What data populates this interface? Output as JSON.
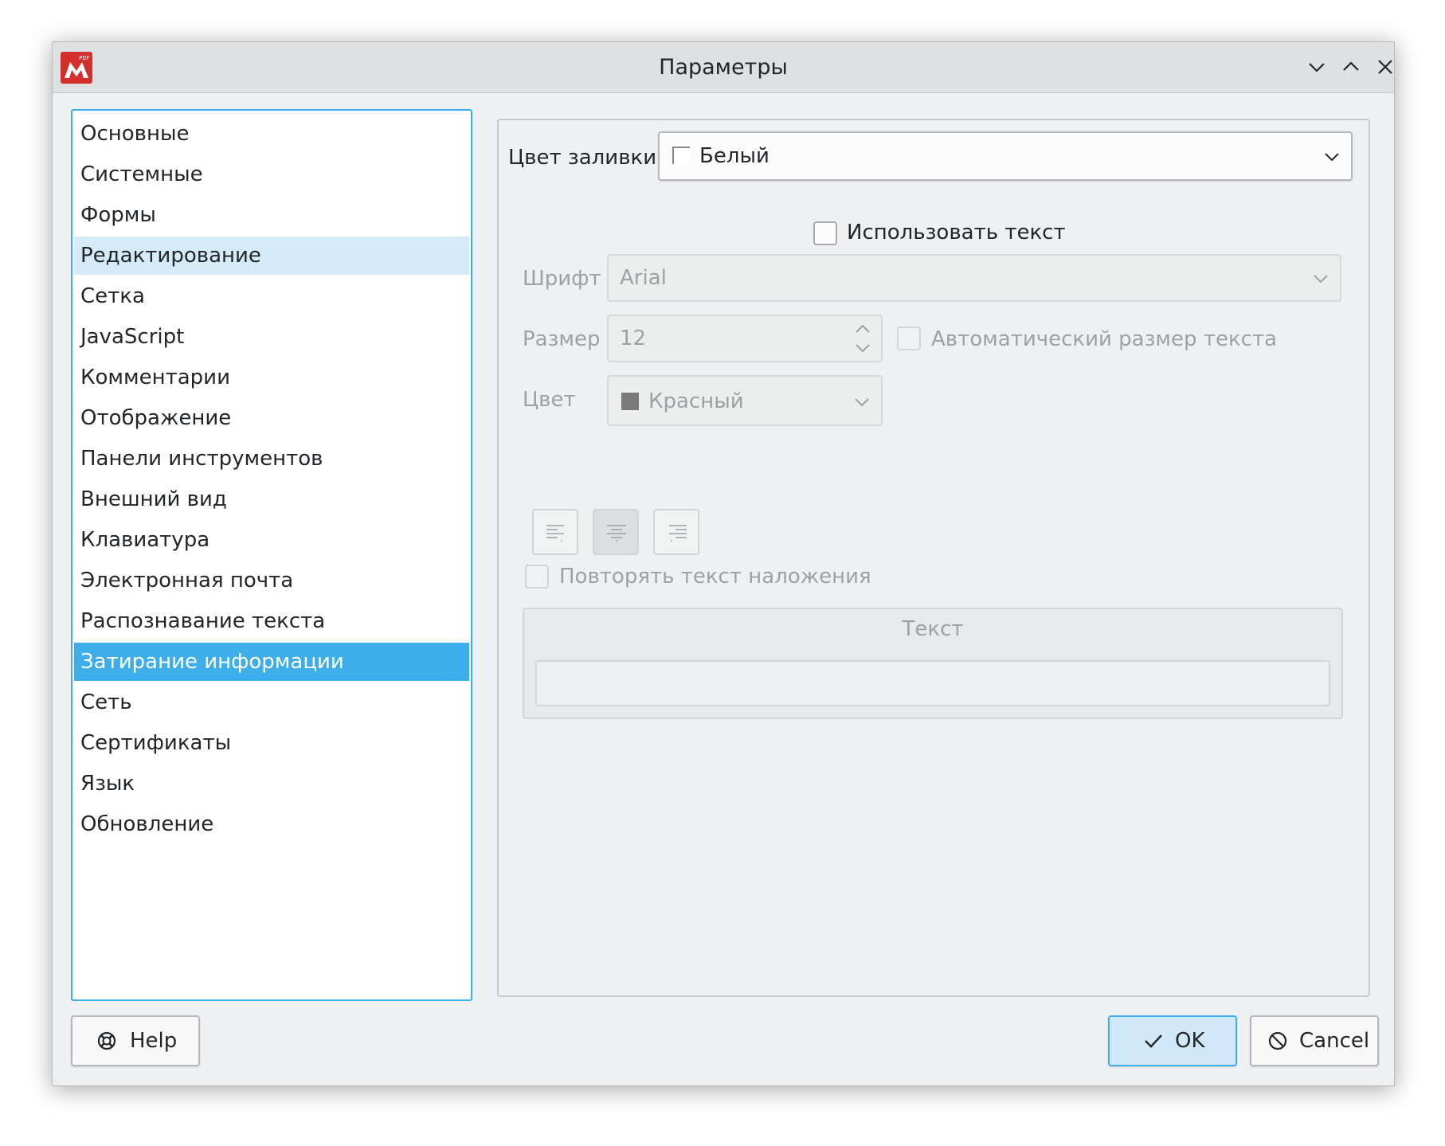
{
  "window": {
    "title": "Параметры",
    "logo_badge": "PDF"
  },
  "categories": [
    {
      "label": "Основные",
      "state": "normal"
    },
    {
      "label": "Системные",
      "state": "normal"
    },
    {
      "label": "Формы",
      "state": "normal"
    },
    {
      "label": "Редактирование",
      "state": "hover"
    },
    {
      "label": "Сетка",
      "state": "normal"
    },
    {
      "label": "JavaScript",
      "state": "normal"
    },
    {
      "label": "Комментарии",
      "state": "normal"
    },
    {
      "label": "Отображение",
      "state": "normal"
    },
    {
      "label": "Панели инструментов",
      "state": "normal"
    },
    {
      "label": "Внешний вид",
      "state": "normal"
    },
    {
      "label": "Клавиатура",
      "state": "normal"
    },
    {
      "label": "Электронная почта",
      "state": "normal"
    },
    {
      "label": "Распознавание текста",
      "state": "normal"
    },
    {
      "label": "Затирание информации",
      "state": "selected"
    },
    {
      "label": "Сеть",
      "state": "normal"
    },
    {
      "label": "Сертификаты",
      "state": "normal"
    },
    {
      "label": "Язык",
      "state": "normal"
    },
    {
      "label": "Обновление",
      "state": "normal"
    }
  ],
  "redaction": {
    "fill_color": {
      "label": "Цвет заливки",
      "value": "Белый",
      "swatch": "#ffffff"
    },
    "use_text": {
      "label": "Использовать текст",
      "checked": false
    },
    "font": {
      "label": "Шрифт",
      "value": "Arial"
    },
    "size": {
      "label": "Размер",
      "value": "12"
    },
    "auto_size": {
      "label": "Автоматический размер текста",
      "checked": false
    },
    "color": {
      "label": "Цвет",
      "value": "Красный",
      "swatch": "#7a7a7a"
    },
    "alignment": {
      "options": [
        "align-left",
        "align-center",
        "align-right"
      ],
      "selected": "align-center"
    },
    "repeat": {
      "label": "Повторять текст наложения",
      "checked": false
    },
    "text_group": {
      "title": "Текст",
      "value": ""
    }
  },
  "buttons": {
    "help": "Help",
    "ok": "OK",
    "cancel": "Cancel"
  },
  "colors": {
    "accent": "#3daee9",
    "hover": "#d6ebf8",
    "logo": "#d32f2f"
  }
}
